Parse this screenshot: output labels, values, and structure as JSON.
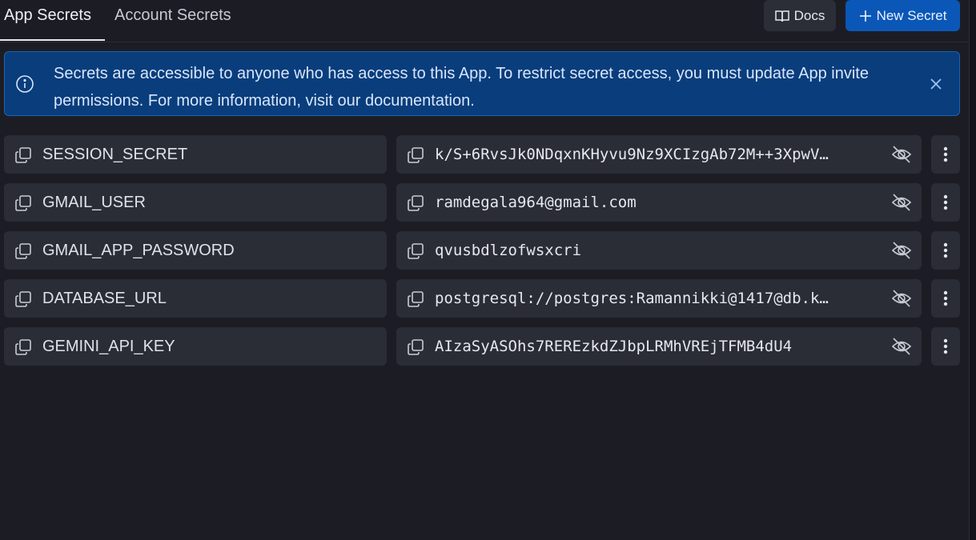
{
  "tabs": {
    "app_secrets": "App Secrets",
    "account_secrets": "Account Secrets"
  },
  "toolbar": {
    "docs_label": "Docs",
    "new_secret_label": "New Secret"
  },
  "banner": {
    "text": "Secrets are accessible to anyone who has access to this App. To restrict secret access, you must update App invite permissions. For more information, visit our documentation."
  },
  "secrets": [
    {
      "key": "SESSION_SECRET",
      "value": "k/S+6RvsJk0NDqxnKHyvu9Nz9XCIzgAb72M++3XpwV…"
    },
    {
      "key": "GMAIL_USER",
      "value": "ramdegala964@gmail.com"
    },
    {
      "key": "GMAIL_APP_PASSWORD",
      "value": "qvusbdlzofwsxcri"
    },
    {
      "key": "DATABASE_URL",
      "value": "postgresql://postgres:Ramannikki@1417@db.k…"
    },
    {
      "key": "GEMINI_API_KEY",
      "value": "AIzaSyASOhs7REREzkdZJbpLRMhVREjTFMB4dU4"
    }
  ],
  "colors": {
    "background": "#1c1d24",
    "cell": "#2b2d36",
    "accent": "#0b57b8",
    "banner": "#0a3d7c"
  },
  "icons": [
    "book-icon",
    "plus-icon",
    "info-icon",
    "close-icon",
    "copy-icon",
    "eye-off-icon",
    "more-vertical-icon"
  ]
}
